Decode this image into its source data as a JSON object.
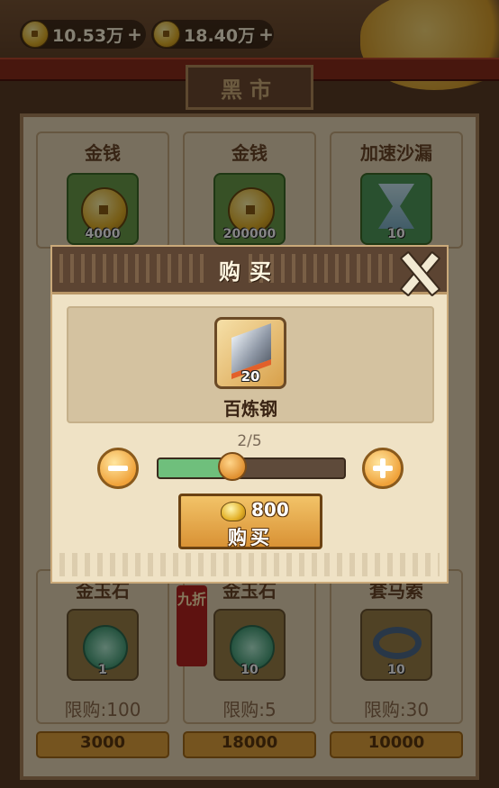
{
  "currency": [
    {
      "value": "10.53万",
      "icon": "gold-ingot-icon"
    },
    {
      "value": "18.40万",
      "icon": "copper-coin-icon"
    }
  ],
  "shop": {
    "title": "黑市",
    "items": [
      {
        "name": "金钱",
        "amount": "4000"
      },
      {
        "name": "金钱",
        "amount": "200000"
      },
      {
        "name": "加速沙漏",
        "amount": "10"
      },
      {
        "name": "金玉石",
        "amount": "1",
        "limit": "限购:100",
        "price": "3000"
      },
      {
        "name": "金玉石",
        "amount": "10",
        "limit": "限购:5",
        "price": "18000",
        "discount": "九折"
      },
      {
        "name": "套马索",
        "amount": "10",
        "limit": "限购:30",
        "price": "10000"
      }
    ]
  },
  "dialog": {
    "title": "购买",
    "item_name": "百炼钢",
    "item_count": "20",
    "quantity_text": "2/5",
    "quantity_fraction": 0.4,
    "price": "800",
    "buy_label": "购买"
  }
}
